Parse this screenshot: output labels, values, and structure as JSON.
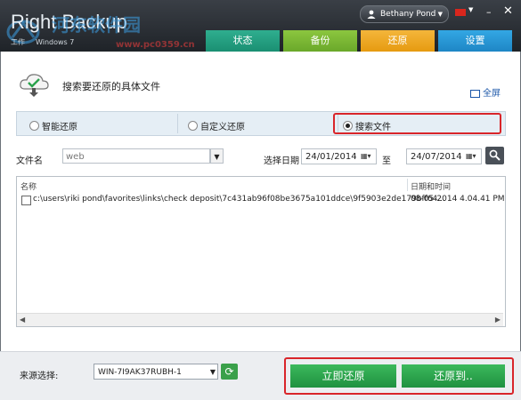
{
  "window": {
    "title": "Right Backup",
    "subtitle_left": "工作",
    "subtitle_os": "Windows 7",
    "watermark": "河东软件园",
    "watermark_url": "www.pc0359.cn",
    "user_name": "Bethany Pond",
    "minimize": "–",
    "close": "✕"
  },
  "tabs": [
    {
      "label": "状态"
    },
    {
      "label": "备份"
    },
    {
      "label": "还原"
    },
    {
      "label": "设置"
    }
  ],
  "page": {
    "heading": "搜索要还原的具体文件",
    "fullscreen": "全屏"
  },
  "options": [
    {
      "label": "智能还原",
      "selected": false
    },
    {
      "label": "自定义还原",
      "selected": false
    },
    {
      "label": "搜索文件",
      "selected": true
    }
  ],
  "filters": {
    "filename_label": "文件名",
    "filename_value": "web",
    "date_label": "选择日期",
    "date_from": "24/01/2014",
    "to_label": "至",
    "date_to": "24/07/2014"
  },
  "results": {
    "columns": [
      "名称",
      "日期和时间"
    ],
    "rows": [
      {
        "path": "c:\\users\\riki pond\\favorites\\links\\check deposit\\7c431ab96f08be3675a101ddce\\9f5903e2de179bff64...",
        "datetime": "08-05-2014 4.04.41 PM"
      }
    ]
  },
  "bottom": {
    "source_label": "来源选择:",
    "source_value": "WIN-7I9AK37RUBH-1",
    "restore_now": "立即还原",
    "restore_to": "还原到.."
  },
  "colors": {
    "tab_status": "#1fa082",
    "tab_backup": "#7ab734",
    "tab_restore": "#eea726",
    "tab_settings": "#2896d3",
    "highlight": "#d9252a",
    "action_green": "#2aa24c"
  },
  "icons": [
    "cloud-download-icon",
    "user-icon",
    "flag-icon",
    "calendar-icon",
    "search-icon",
    "refresh-icon"
  ]
}
